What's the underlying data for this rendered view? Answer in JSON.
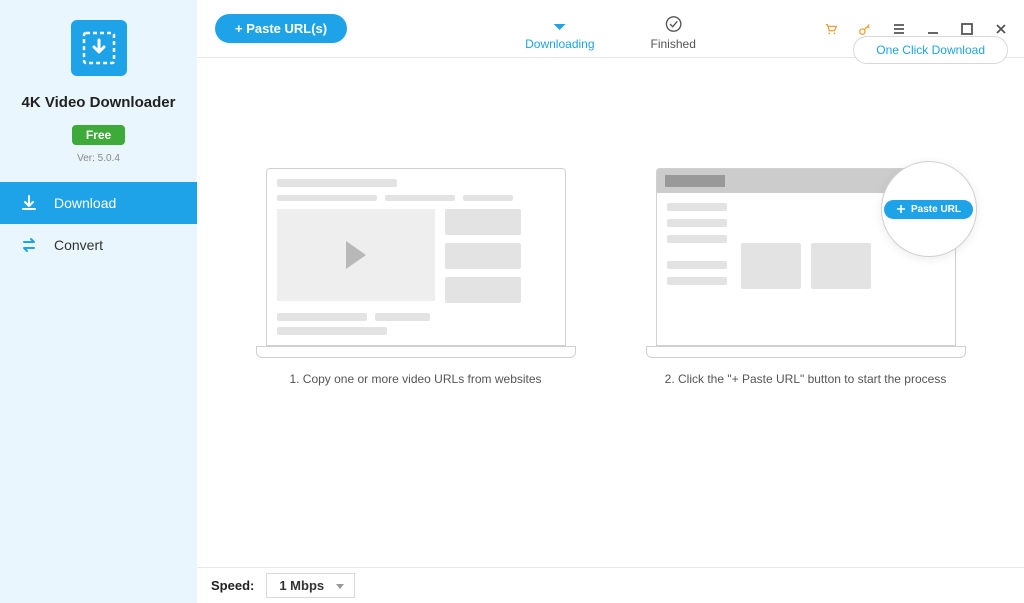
{
  "app": {
    "title": "4K Video Downloader",
    "badge": "Free",
    "version": "Ver: 5.0.4"
  },
  "sidebar": {
    "items": [
      {
        "label": "Download",
        "icon": "download-icon"
      },
      {
        "label": "Convert",
        "icon": "convert-icon"
      }
    ]
  },
  "header": {
    "paste_button": "+ Paste URL(s)",
    "tabs": [
      {
        "label": "Downloading",
        "icon": "download-arrow-icon"
      },
      {
        "label": "Finished",
        "icon": "check-circle-icon"
      }
    ],
    "one_click": "One Click Download"
  },
  "guide": {
    "step1": "1. Copy one or more video URLs from websites",
    "step2": "2. Click the \"+ Paste URL\" button to start the process",
    "paste_mini": "Paste URL"
  },
  "footer": {
    "speed_label": "Speed:",
    "speed_value": "1 Mbps"
  },
  "colors": {
    "primary": "#1fa3e8",
    "sidebar_bg": "#eaf6fd",
    "badge_green": "#3eaa3a"
  }
}
